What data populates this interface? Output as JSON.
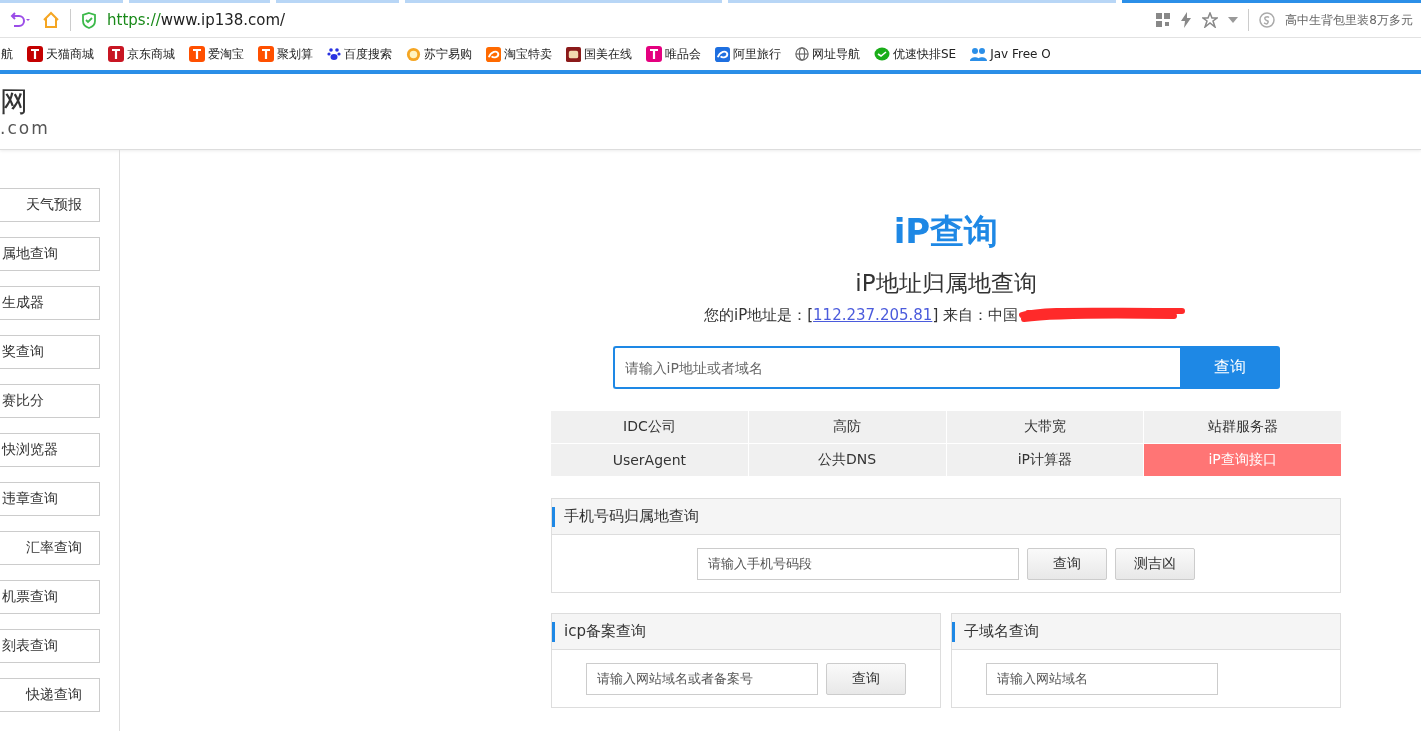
{
  "browser": {
    "url_scheme": "https://",
    "url_rest": "www.ip138.com/",
    "search_hint": "高中生背包里装8万多元"
  },
  "bookmarks": [
    {
      "label": "航"
    },
    {
      "label": "天猫商城"
    },
    {
      "label": "京东商城"
    },
    {
      "label": "爱淘宝"
    },
    {
      "label": "聚划算"
    },
    {
      "label": "百度搜索"
    },
    {
      "label": "苏宁易购"
    },
    {
      "label": "淘宝特卖"
    },
    {
      "label": "国美在线"
    },
    {
      "label": "唯品会"
    },
    {
      "label": "阿里旅行"
    },
    {
      "label": "网址导航"
    },
    {
      "label": "优速快排SE"
    },
    {
      "label": "Jav Free O"
    }
  ],
  "logo": {
    "name": "网",
    "domain": ".com"
  },
  "sidebar": {
    "items": [
      {
        "label": "天气预报",
        "cut": false
      },
      {
        "label": "属地查询",
        "cut": true
      },
      {
        "label": "生成器",
        "cut": true
      },
      {
        "label": "奖查询",
        "cut": true
      },
      {
        "label": "赛比分",
        "cut": true
      },
      {
        "label": "快浏览器",
        "cut": true
      },
      {
        "label": "违章查询",
        "cut": true
      },
      {
        "label": "汇率查询",
        "cut": false
      },
      {
        "label": "机票查询",
        "cut": true
      },
      {
        "label": "刻表查询",
        "cut": true
      },
      {
        "label": "快递查询",
        "cut": false
      }
    ]
  },
  "main": {
    "title": "iP查询",
    "subtitle": "iP地址归属地查询",
    "ip_prefix": "您的iP地址是：[",
    "ip": "112.237.205.81",
    "ip_suffix": "] 来自：中国",
    "search": {
      "placeholder": "请输入iP地址或者域名",
      "button": "查询"
    },
    "links": [
      {
        "label": "IDC公司",
        "selected": false
      },
      {
        "label": "高防",
        "selected": false
      },
      {
        "label": "大带宽",
        "selected": false
      },
      {
        "label": "站群服务器",
        "selected": false
      },
      {
        "label": "UserAgent",
        "selected": false
      },
      {
        "label": "公共DNS",
        "selected": false
      },
      {
        "label": "iP计算器",
        "selected": false
      },
      {
        "label": "iP查询接口",
        "selected": true
      }
    ],
    "phone_panel": {
      "title": "手机号码归属地查询",
      "placeholder": "请输入手机号码段",
      "buttons": [
        "查询",
        "测吉凶"
      ]
    },
    "icp_panel": {
      "title": "icp备案查询",
      "placeholder": "请输入网站域名或者备案号",
      "buttons": [
        "查询"
      ]
    },
    "subdomain_panel": {
      "title": "子域名查询",
      "placeholder": "请输入网站域名"
    }
  }
}
